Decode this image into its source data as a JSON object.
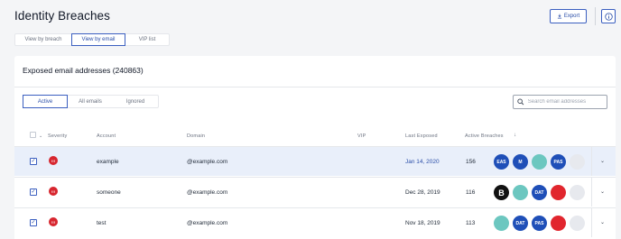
{
  "page": {
    "title": "Identity Breaches"
  },
  "toolbar": {
    "export_label": "Export"
  },
  "view_tabs": [
    "View by breach",
    "View by email",
    "VIP list"
  ],
  "card": {
    "title": "Exposed email addresses (240863)"
  },
  "filter_tabs": [
    "Active",
    "All emails",
    "Ignored"
  ],
  "search": {
    "placeholder": "Search email addresses"
  },
  "table": {
    "headers": {
      "severity": "Severity",
      "account": "Account",
      "domain": "Domain",
      "vip": "VIP",
      "last_exposed": "Last Exposed",
      "active_breaches": "Active Breaches"
    },
    "rows": [
      {
        "account": "example",
        "domain": "@example.com",
        "last_exposed": "Jan 14, 2020",
        "active_breaches": "156",
        "badges": [
          {
            "label": "EAS",
            "color": "#1f4fb8"
          },
          {
            "label": "M",
            "color": "#1f4fb8"
          },
          {
            "label": "",
            "color": "#6cc7c0"
          },
          {
            "label": "PAS",
            "color": "#1f4fb8"
          },
          {
            "label": "",
            "color": "#e7e9ee"
          }
        ]
      },
      {
        "account": "someone",
        "domain": "@example.com",
        "last_exposed": "Dec 28, 2019",
        "active_breaches": "116",
        "badges": [
          {
            "label": "B",
            "color": "#111111"
          },
          {
            "label": "",
            "color": "#6cc7c0"
          },
          {
            "label": "DAT",
            "color": "#1f4fb8"
          },
          {
            "label": "",
            "color": "#e1262e"
          },
          {
            "label": "",
            "color": "#e7e9ee"
          }
        ]
      },
      {
        "account": "test",
        "domain": "@example.com",
        "last_exposed": "Nov 18, 2019",
        "active_breaches": "113",
        "badges": [
          {
            "label": "",
            "color": "#6cc7c0"
          },
          {
            "label": "DAT",
            "color": "#1f4fb8"
          },
          {
            "label": "PAS",
            "color": "#1f4fb8"
          },
          {
            "label": "",
            "color": "#e1262e"
          },
          {
            "label": "",
            "color": "#e7e9ee"
          }
        ]
      }
    ]
  },
  "colors": {
    "accent": "#2a4ea8",
    "severity": "#d7262f",
    "selected_row": "#e9effa"
  },
  "icons": [
    "download-icon",
    "info-icon",
    "search-icon",
    "chevron-down-icon",
    "sort-down-icon",
    "severity-alert-icon"
  ]
}
